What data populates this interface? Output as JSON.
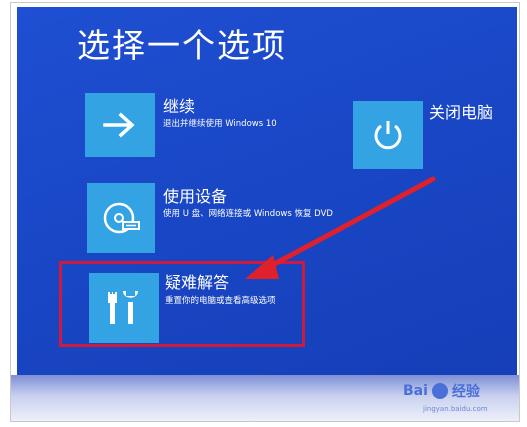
{
  "screen": {
    "title": "选择一个选项"
  },
  "options": [
    {
      "title": "继续",
      "description": "退出并继续使用 Windows 10",
      "icon": "arrow-right-icon"
    },
    {
      "title": "使用设备",
      "description": "使用 U 盘、网络连接或 Windows 恢复 DVD",
      "icon": "disc-device-icon"
    },
    {
      "title": "疑难解答",
      "description": "重置你的电脑或查看高级选项",
      "icon": "tools-icon"
    },
    {
      "title": "关闭电脑",
      "icon": "power-icon"
    }
  ],
  "watermark": {
    "brand_a": "Bai",
    "brand_b": "经验",
    "sub": "jingyan.baidu.com"
  },
  "colors": {
    "background": "#1a49c9",
    "tile": "#33a3e4",
    "highlight": "#cc1b3d",
    "arrow": "#e0202a"
  }
}
